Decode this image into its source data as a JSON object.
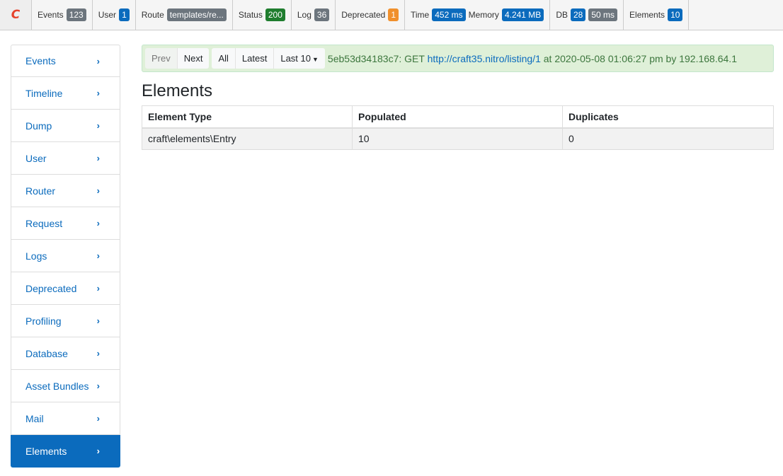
{
  "toolbar": {
    "logo": "C",
    "blocks": [
      {
        "label": "Events",
        "badge": "123"
      },
      {
        "label": "User",
        "badge": "1"
      },
      {
        "label": "Route",
        "badge": "templates/re..."
      },
      {
        "label": "Status",
        "badge": "200"
      },
      {
        "label": "Log",
        "badge": "36"
      },
      {
        "label": "Deprecated",
        "badge": "1"
      },
      {
        "label": "Time",
        "badge": "452 ms",
        "label2": "Memory",
        "badge2": "4.241 MB"
      },
      {
        "label": "DB",
        "badge": "28",
        "badge2": "50 ms"
      },
      {
        "label": "Elements",
        "badge": "10"
      }
    ]
  },
  "sidebar": {
    "items": [
      {
        "label": "Events"
      },
      {
        "label": "Timeline"
      },
      {
        "label": "Dump"
      },
      {
        "label": "User"
      },
      {
        "label": "Router"
      },
      {
        "label": "Request"
      },
      {
        "label": "Logs"
      },
      {
        "label": "Deprecated"
      },
      {
        "label": "Profiling"
      },
      {
        "label": "Database"
      },
      {
        "label": "Asset Bundles"
      },
      {
        "label": "Mail"
      },
      {
        "label": "Elements"
      }
    ],
    "chevron": "›"
  },
  "summary": {
    "prev": "Prev",
    "next": "Next",
    "all": "All",
    "latest": "Latest",
    "last": "Last 10",
    "tag_text": "5eb53d34183c7: GET ",
    "url": "http://craft35.nitro/listing/1",
    "after_text": " at 2020-05-08 01:06:27 pm by 192.168.64.1"
  },
  "page": {
    "title": "Elements"
  },
  "table": {
    "headers": [
      "Element Type",
      "Populated",
      "Duplicates"
    ],
    "rows": [
      [
        "craft\\elements\\Entry",
        "10",
        "0"
      ]
    ]
  }
}
